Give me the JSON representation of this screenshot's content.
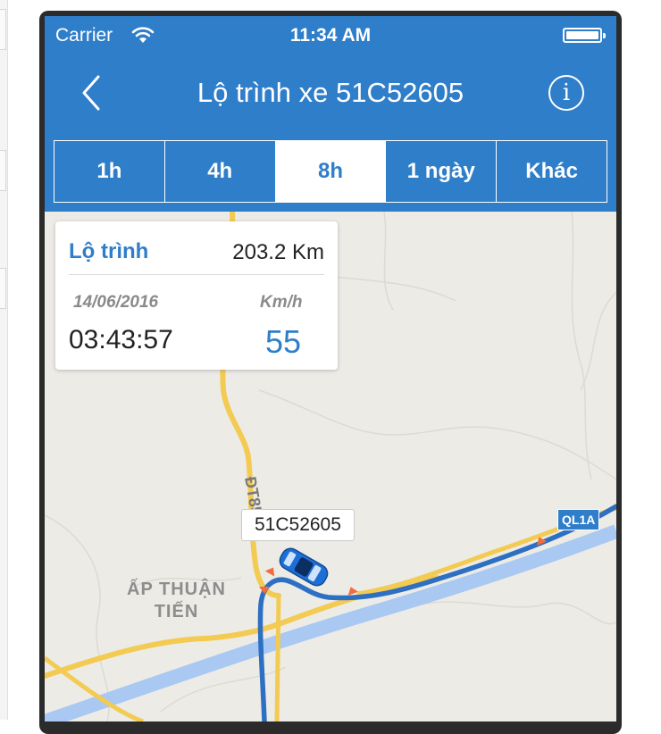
{
  "status_bar": {
    "carrier": "Carrier",
    "time": "11:34 AM"
  },
  "nav": {
    "title": "Lộ trình xe 51C52605",
    "back_icon": "chevron-left-icon",
    "info_icon": "info-icon",
    "info_glyph": "i"
  },
  "segments": {
    "items": [
      {
        "label": "1h"
      },
      {
        "label": "4h"
      },
      {
        "label": "8h"
      },
      {
        "label": "1 ngày"
      },
      {
        "label": "Khác"
      }
    ],
    "selected": "8h"
  },
  "info_card": {
    "route_label": "Lộ trình",
    "distance": "203.2 Km",
    "date": "14/06/2016",
    "time": "03:43:57",
    "speed_unit": "Km/h",
    "speed": "55"
  },
  "map": {
    "vehicle_label": "51C52605",
    "road_labels": [
      "ĐT854",
      "QL1A"
    ],
    "place_label_line1": "ẤP THUẬN",
    "place_label_line2": "TIẾN"
  },
  "colors": {
    "accent": "#2f7ec9",
    "route": "#2d6fc2",
    "road_major": "#f3cb52",
    "river": "#a9c8f2",
    "map_background": "#ecebe6",
    "marker": "#f26d3d"
  }
}
